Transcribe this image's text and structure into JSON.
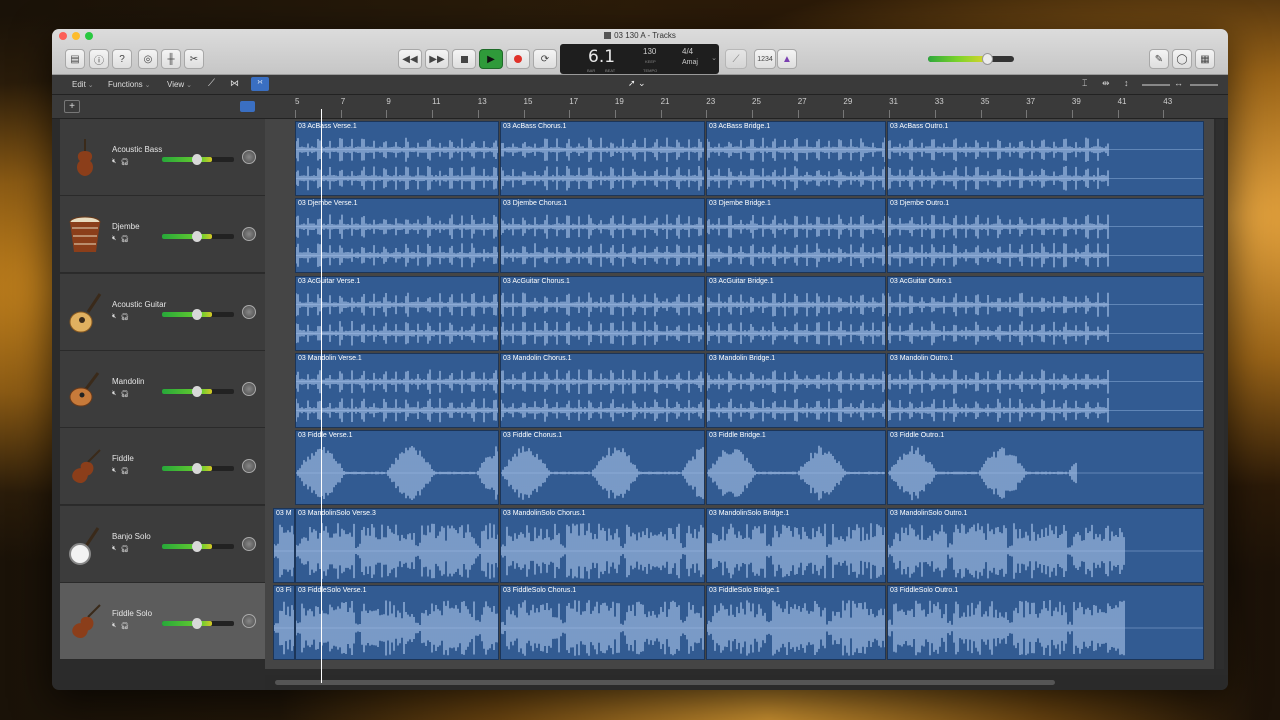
{
  "window": {
    "title": "03 130 A - Tracks"
  },
  "toolbar": {
    "lcd": {
      "position": "6.1",
      "bar_label": "BAR",
      "beat_label": "BEAT",
      "tempo": "130",
      "tempo_mode": "KEEP",
      "tempo_label": "TEMPO",
      "signature": "4/4",
      "key": "Amaj"
    },
    "count_in": "1234"
  },
  "menubar": {
    "edit": "Edit",
    "functions": "Functions",
    "view": "View"
  },
  "ruler": {
    "bars": [
      "5",
      "7",
      "9",
      "11",
      "13",
      "15",
      "17",
      "19",
      "21",
      "23",
      "25",
      "27",
      "29",
      "31",
      "33",
      "35",
      "37",
      "39",
      "41",
      "43"
    ]
  },
  "tracks": [
    {
      "name": "Acoustic Bass",
      "icon": "bass-icon",
      "regions": [
        "03 AcBass Verse.1",
        "03 AcBass Chorus.1",
        "03 AcBass Bridge.1",
        "03 AcBass Outro.1"
      ]
    },
    {
      "name": "Djembe",
      "icon": "djembe-icon",
      "regions": [
        "03 Djembe Verse.1",
        "03 Djembe Chorus.1",
        "03 Djembe Bridge.1",
        "03 Djembe Outro.1"
      ]
    },
    {
      "name": "Acoustic Guitar",
      "icon": "guitar-icon",
      "regions": [
        "03 AcGuitar Verse.1",
        "03 AcGuitar Chorus.1",
        "03 AcGuitar Bridge.1",
        "03 AcGuitar Outro.1"
      ]
    },
    {
      "name": "Mandolin",
      "icon": "mandolin-icon",
      "regions": [
        "03 Mandolin Verse.1",
        "03 Mandolin Chorus.1",
        "03 Mandolin Bridge.1",
        "03 Mandolin Outro.1"
      ]
    },
    {
      "name": "Fiddle",
      "icon": "fiddle-icon",
      "regions": [
        "03 Fiddle Verse.1",
        "03 Fiddle Chorus.1",
        "03 Fiddle Bridge.1",
        "03 Fiddle Outro.1"
      ]
    },
    {
      "name": "Banjo Solo",
      "icon": "banjo-icon",
      "pre": "03 M",
      "regions": [
        "03 MandolinSolo Verse.3",
        "03 MandolinSolo Chorus.1",
        "03 MandolinSolo Bridge.1",
        "03 MandolinSolo Outro.1"
      ]
    },
    {
      "name": "Fiddle Solo",
      "icon": "fiddle-icon",
      "pre": "03 Fi",
      "regions": [
        "03 FiddleSolo Verse.1",
        "03 FiddleSolo Chorus.1",
        "03 FiddleSolo Bridge.1",
        "03 FiddleSolo Outro.1"
      ]
    }
  ]
}
